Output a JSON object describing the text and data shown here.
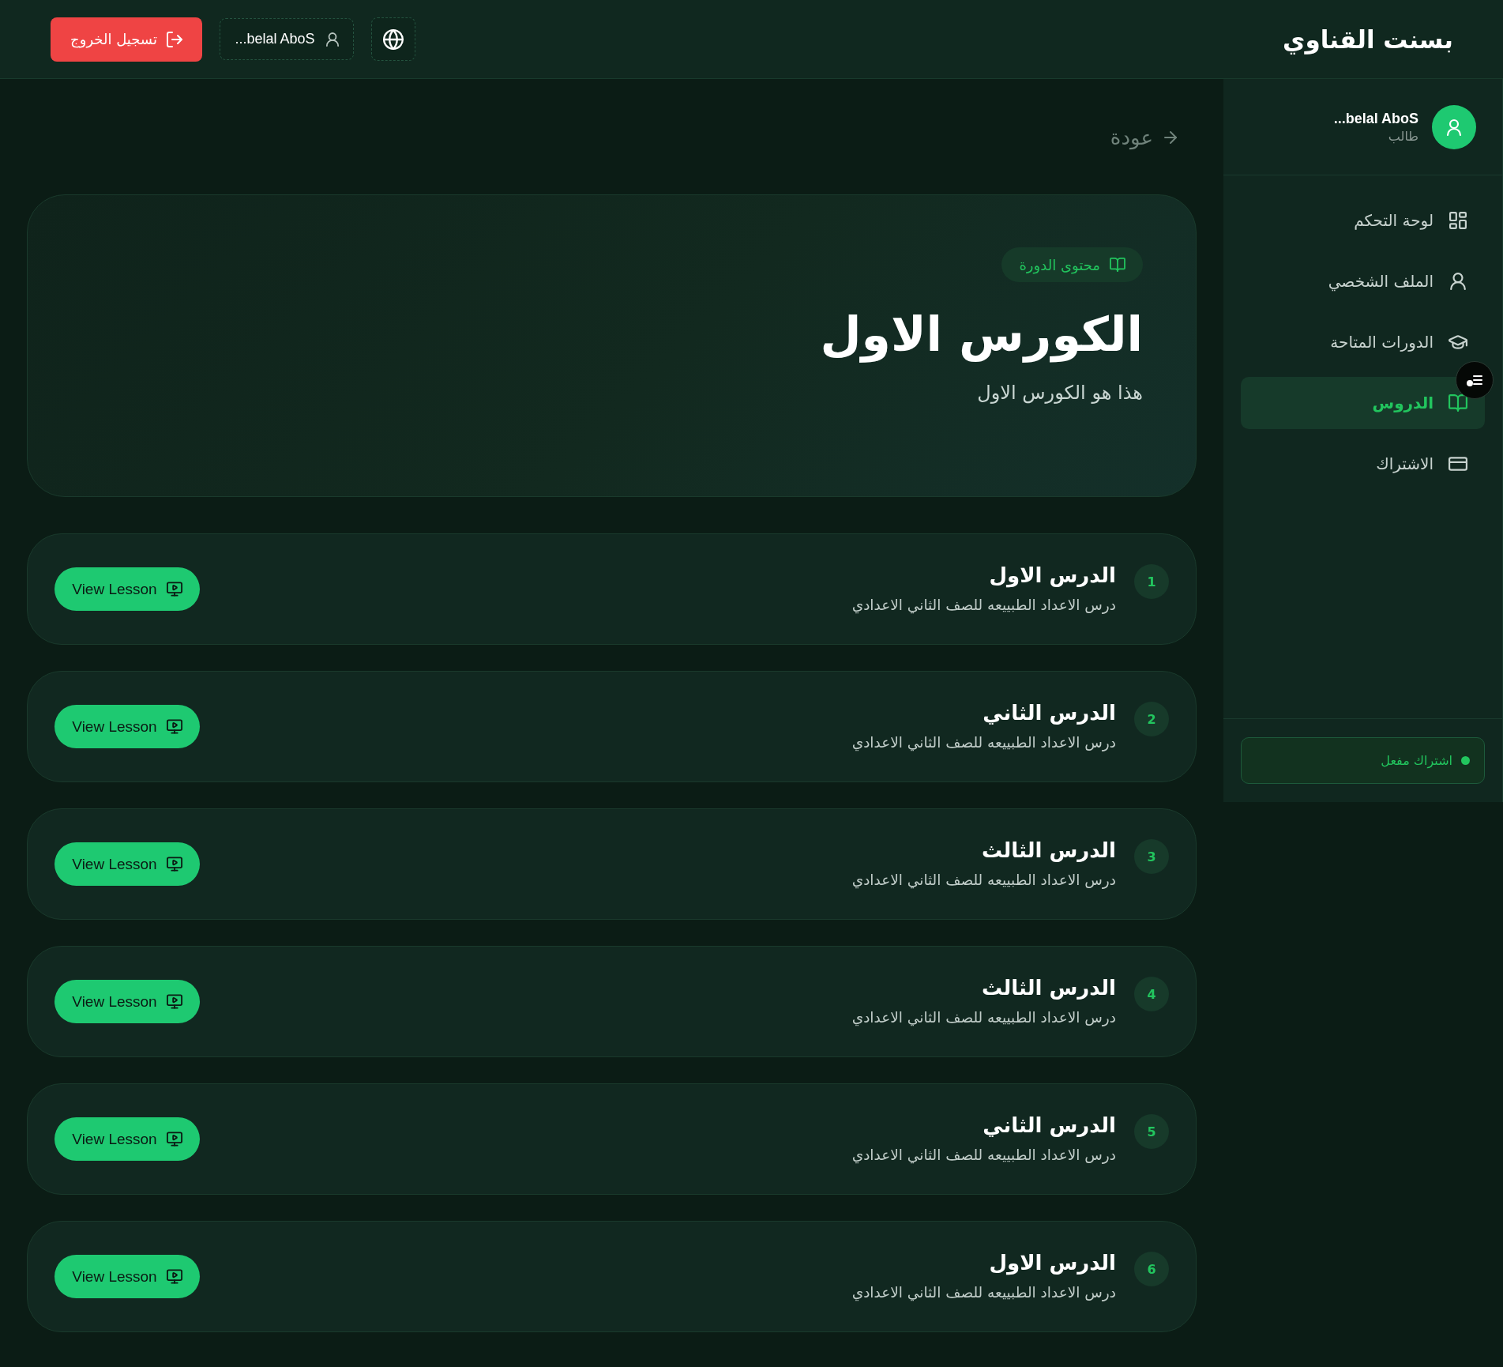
{
  "header": {
    "title": "بسنت القناوي",
    "user_button": "belal AboS...",
    "logout_button": "تسجيل الخروج"
  },
  "sidebar": {
    "profile": {
      "name": "belal AboS...",
      "role": "طالب"
    },
    "nav_items": [
      {
        "label": "لوحة التحكم",
        "selected": false
      },
      {
        "label": "الملف الشخصي",
        "selected": false
      },
      {
        "label": "الدورات المتاحة",
        "selected": false
      },
      {
        "label": "الدروس",
        "selected": true
      },
      {
        "label": "الاشتراك",
        "selected": false
      }
    ],
    "subscription": {
      "label": "اشتراك مفعل",
      "active": true
    }
  },
  "main": {
    "back_link": "عودة",
    "course": {
      "tag": "محتوى الدورة",
      "title": "الكورس الاول",
      "description": "هذا هو الكورس الاول"
    },
    "lessons": [
      {
        "number": "1",
        "title": "الدرس الاول",
        "description": "درس الاعداد الطبييعه للصف الثاني الاعدادي",
        "button": "View Lesson"
      },
      {
        "number": "2",
        "title": "الدرس الثاني",
        "description": "درس الاعداد الطبييعه للصف الثاني الاعدادي",
        "button": "View Lesson"
      },
      {
        "number": "3",
        "title": "الدرس الثالث",
        "description": "درس الاعداد الطبييعه للصف الثاني الاعدادي",
        "button": "View Lesson"
      },
      {
        "number": "4",
        "title": "الدرس الثالث",
        "description": "درس الاعداد الطبييعه للصف الثاني الاعدادي",
        "button": "View Lesson"
      },
      {
        "number": "5",
        "title": "الدرس الثاني",
        "description": "درس الاعداد الطبييعه للصف الثاني الاعدادي",
        "button": "View Lesson"
      },
      {
        "number": "6",
        "title": "الدرس الاول",
        "description": "درس الاعداد الطبييعه للصف الثاني الاعدادي",
        "button": "View Lesson"
      }
    ]
  }
}
